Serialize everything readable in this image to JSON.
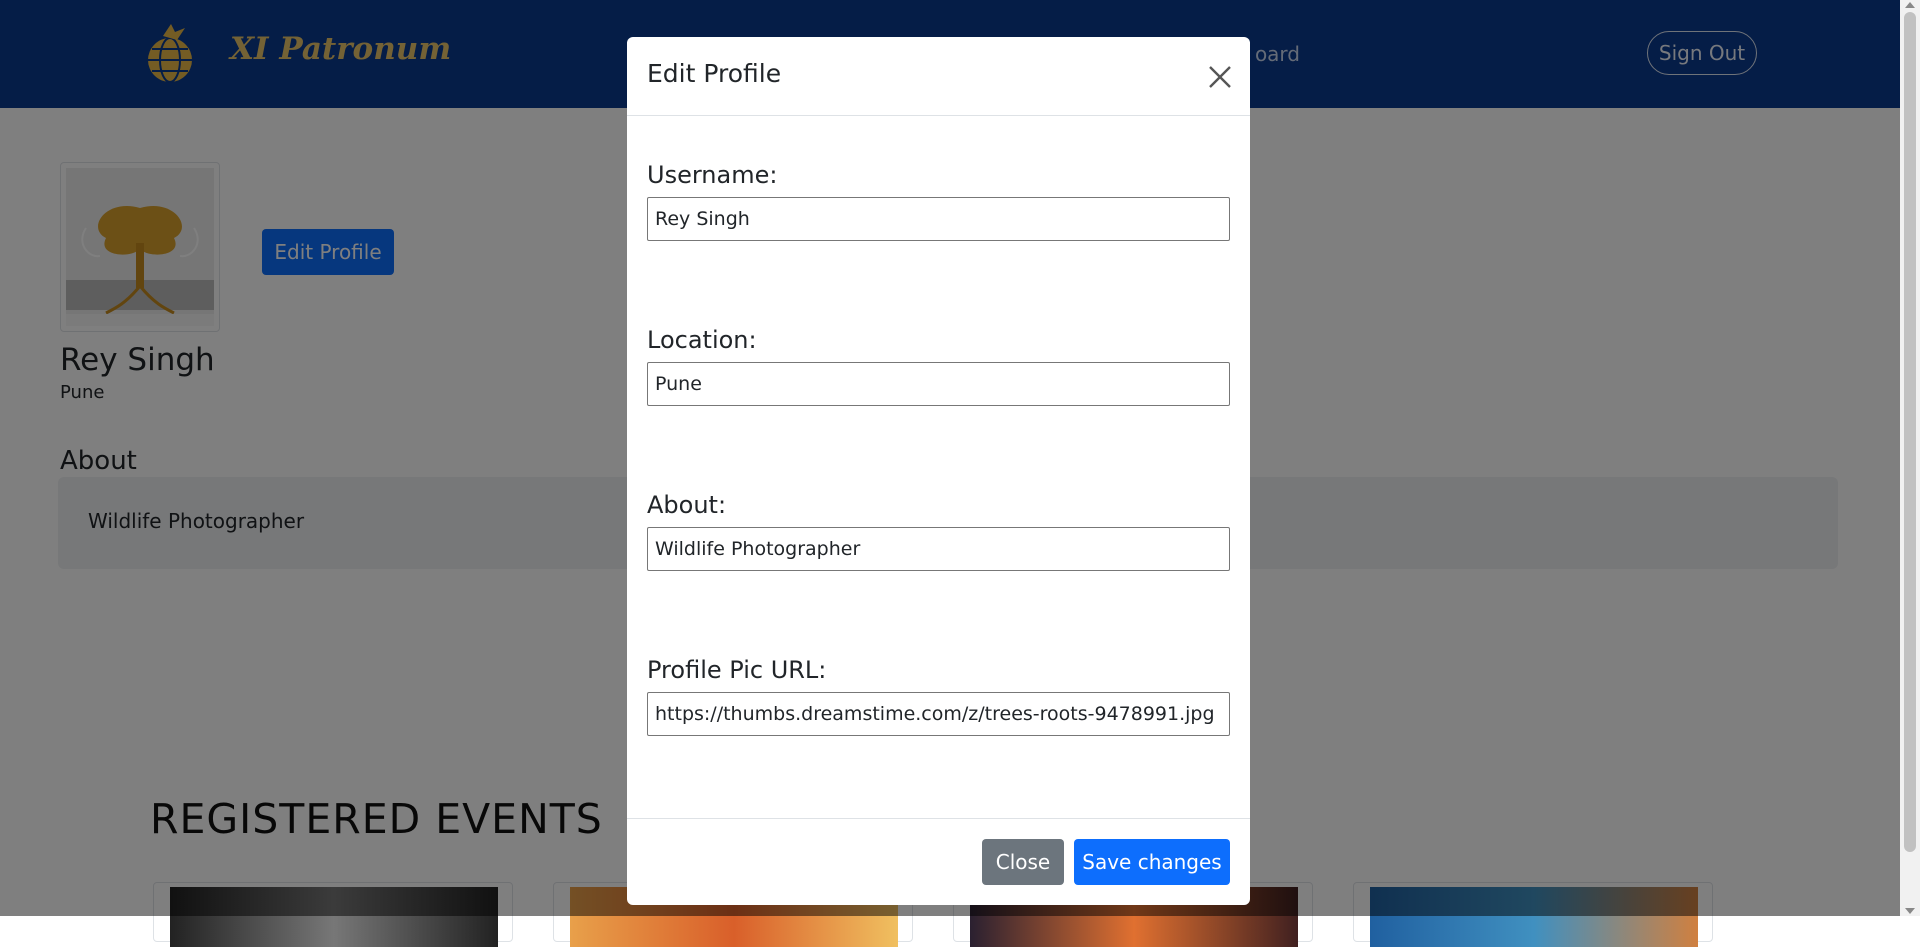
{
  "navbar": {
    "brand": "XI Patronum",
    "partial_link": "oard",
    "signout_label": "Sign Out"
  },
  "profile": {
    "edit_button_label": "Edit Profile",
    "name": "Rey Singh",
    "location": "Pune",
    "about_heading": "About",
    "about_text": "Wildlife Photographer"
  },
  "events": {
    "heading": "REGISTERED EVENTS"
  },
  "modal": {
    "title": "Edit Profile",
    "fields": [
      {
        "label": "Username:",
        "value": "Rey Singh"
      },
      {
        "label": "Location:",
        "value": "Pune"
      },
      {
        "label": "About:",
        "value": "Wildlife Photographer"
      },
      {
        "label": "Profile Pic URL:",
        "value": "https://thumbs.dreamstime.com/z/trees-roots-9478991.jpg"
      }
    ],
    "close_label": "Close",
    "save_label": "Save changes"
  },
  "colors": {
    "navbar": "#0b3a8f",
    "primary": "#0d6efd",
    "secondary": "#6c757d",
    "brand": "#e9c46a"
  },
  "icons": {
    "logo": "globe-bird-logo-icon",
    "modal_close": "close-icon"
  }
}
